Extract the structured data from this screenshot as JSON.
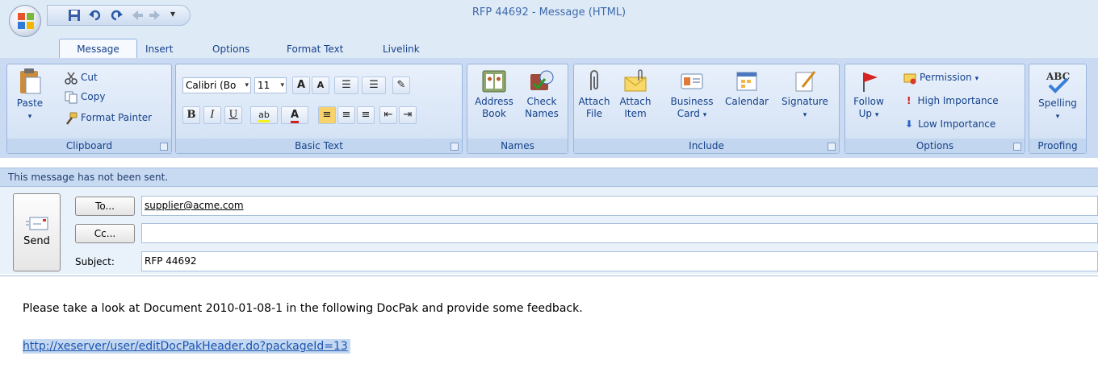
{
  "window": {
    "title": "RFP 44692 - Message (HTML)"
  },
  "tabs": [
    "Message",
    "Insert",
    "Options",
    "Format Text",
    "Livelink"
  ],
  "ribbon": {
    "clipboard": {
      "label": "Clipboard",
      "paste": "Paste",
      "cut": "Cut",
      "copy": "Copy",
      "format_painter": "Format Painter"
    },
    "basic_text": {
      "label": "Basic Text",
      "font": "Calibri (Bo",
      "size": "11"
    },
    "names": {
      "label": "Names",
      "address_book": [
        "Address",
        "Book"
      ],
      "check_names": [
        "Check",
        "Names"
      ]
    },
    "include": {
      "label": "Include",
      "attach_file": [
        "Attach",
        "File"
      ],
      "attach_item": [
        "Attach",
        "Item"
      ],
      "business_card": [
        "Business",
        "Card"
      ],
      "calendar": "Calendar",
      "signature": "Signature"
    },
    "options": {
      "label": "Options",
      "follow_up": [
        "Follow",
        "Up"
      ],
      "permission": "Permission",
      "high_importance": "High Importance",
      "low_importance": "Low Importance"
    },
    "proofing": {
      "label": "Proofing",
      "spelling": "Spelling"
    }
  },
  "infobar": "This message has not been sent.",
  "compose": {
    "send_label": "Send",
    "to_button": "To...",
    "cc_button": "Cc...",
    "subject_label": "Subject:",
    "to_value": "supplier@acme.com",
    "cc_value": "",
    "subject_value": "RFP 44692"
  },
  "body": {
    "text": "Please take a look at Document 2010-01-08-1 in the following DocPak and provide some feedback.",
    "link": "http://xeserver/user/editDocPakHeader.do?packageId=13"
  },
  "colors": {
    "ribbon": "#c9daf2",
    "accent_text": "#15428b",
    "link": "#1a54b0",
    "selection": "#c5d8f2"
  }
}
